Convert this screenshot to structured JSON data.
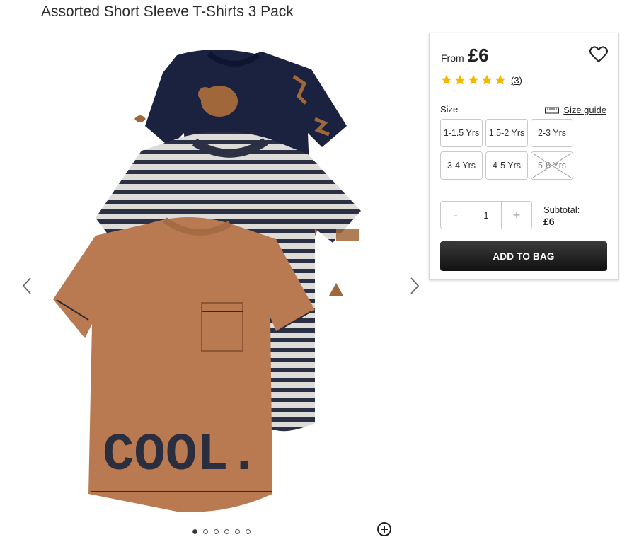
{
  "product": {
    "title": "Assorted Short Sleeve T-Shirts 3 Pack",
    "image_text": "COOL."
  },
  "gallery": {
    "dot_count": 6,
    "active_dot": 0
  },
  "pricing": {
    "from_label": "From",
    "price": "£6"
  },
  "rating": {
    "stars": 5,
    "review_count": "(3)",
    "star_color": "#f5b800"
  },
  "size": {
    "label": "Size",
    "guide_label": "Size guide",
    "options": [
      {
        "label": "1-1.5 Yrs",
        "available": true
      },
      {
        "label": "1.5-2 Yrs",
        "available": true
      },
      {
        "label": "2-3 Yrs",
        "available": true
      },
      {
        "label": "3-4 Yrs",
        "available": true
      },
      {
        "label": "4-5 Yrs",
        "available": true
      },
      {
        "label": "5-6 Yrs",
        "available": false
      }
    ]
  },
  "quantity": {
    "minus": "-",
    "value": "1",
    "plus": "+"
  },
  "subtotal": {
    "label": "Subtotal:",
    "amount": "£6"
  },
  "cart": {
    "add_label": "ADD TO BAG"
  },
  "icons": [
    "heart-icon",
    "star-icon",
    "ruler-icon",
    "chevron-left-icon",
    "chevron-right-icon",
    "zoom-in-icon"
  ]
}
